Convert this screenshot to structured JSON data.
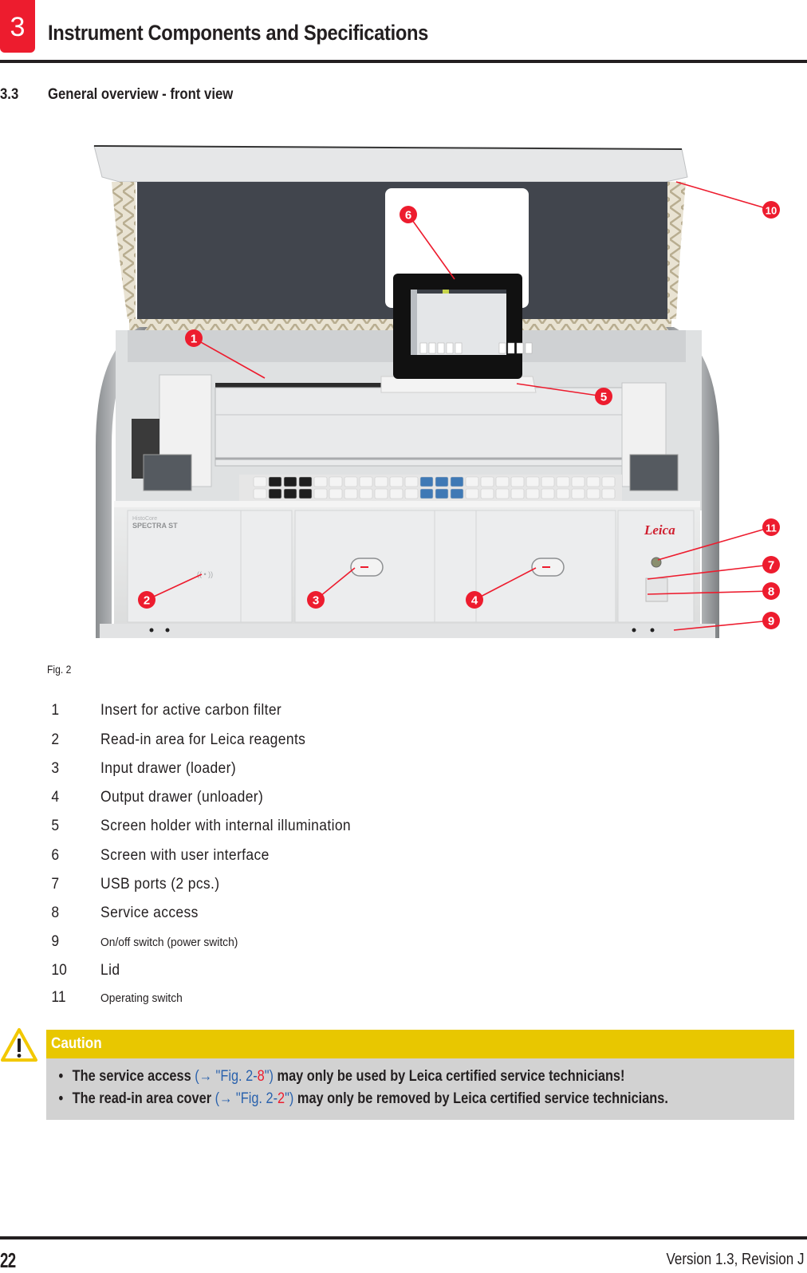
{
  "header": {
    "chapter_number": "3",
    "chapter_title": "Instrument Components and Specifications"
  },
  "section": {
    "number": "3.3",
    "title": "General overview - front view"
  },
  "figure": {
    "caption": "Fig. 2",
    "device_brand_line1": "HistoCore",
    "device_brand_line2": "SPECTRA ST",
    "logo_text": "Leica",
    "callouts": [
      "1",
      "2",
      "3",
      "4",
      "5",
      "6",
      "7",
      "8",
      "9",
      "10",
      "11"
    ]
  },
  "legend": [
    {
      "num": "1",
      "text": "Insert for active carbon filter"
    },
    {
      "num": "2",
      "text": "Read-in area for Leica reagents"
    },
    {
      "num": "3",
      "text": "Input drawer (loader)"
    },
    {
      "num": "4",
      "text": "Output drawer (unloader)"
    },
    {
      "num": "5",
      "text": "Screen holder with internal illumination"
    },
    {
      "num": "6",
      "text": "Screen with user interface"
    },
    {
      "num": "7",
      "text": "USB ports (2 pcs.)"
    },
    {
      "num": "8",
      "text": "Service access"
    },
    {
      "num": "9",
      "text": "On/off switch (power switch)"
    },
    {
      "num": "10",
      "text": "Lid"
    },
    {
      "num": "11",
      "text": "Operating switch"
    }
  ],
  "caution": {
    "title": "Caution",
    "items": [
      {
        "bold_before": "The service access ",
        "xref_prefix": "(→ \"Fig. 2-",
        "xref_num": "8",
        "xref_suffix": "\")",
        "bold_after": " may only be used by Leica certified service technicians!"
      },
      {
        "bold_before": "The read-in area cover ",
        "xref_prefix": "(→ \"Fig. 2-",
        "xref_num": "2",
        "xref_suffix": "\")",
        "bold_after": " may only be removed by Leica certified service technicians."
      }
    ]
  },
  "footer": {
    "page_number": "22",
    "version": "Version 1.3, Revision J"
  },
  "colors": {
    "accent_red": "#ed1c2e",
    "caution_yellow": "#e8c700",
    "caution_gray": "#d2d2d2",
    "xref_blue": "#2a62ad"
  }
}
